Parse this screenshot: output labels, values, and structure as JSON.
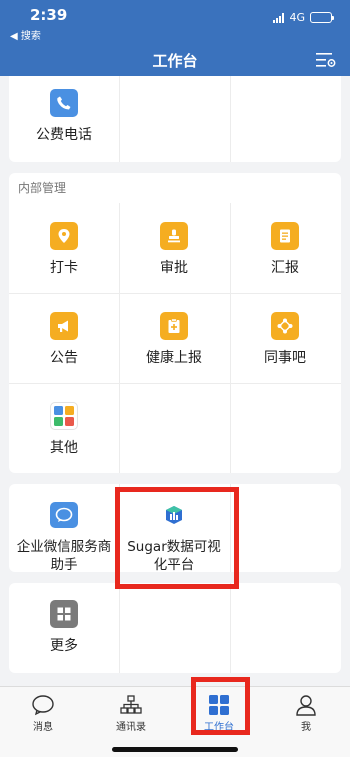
{
  "status": {
    "time": "2:39",
    "back": "◀ 搜索",
    "network": "4G"
  },
  "header": {
    "title": "工作台"
  },
  "section_top": {
    "items": [
      {
        "label": "公费电话",
        "icon": "phone-icon"
      }
    ]
  },
  "section_internal": {
    "title": "内部管理",
    "items": [
      {
        "label": "打卡",
        "icon": "location-pin-icon"
      },
      {
        "label": "审批",
        "icon": "stamp-icon"
      },
      {
        "label": "汇报",
        "icon": "report-doc-icon"
      },
      {
        "label": "公告",
        "icon": "megaphone-icon"
      },
      {
        "label": "健康上报",
        "icon": "health-report-icon"
      },
      {
        "label": "同事吧",
        "icon": "colleague-network-icon"
      },
      {
        "label": "其他",
        "icon": "app-grid-colorful-icon"
      }
    ]
  },
  "section_apps": {
    "items": [
      {
        "label": "企业微信服务商助手",
        "icon": "chat-bubble-icon"
      },
      {
        "label": "Sugar数据可视化平台",
        "icon": "sugar-logo-icon"
      }
    ]
  },
  "section_more": {
    "items": [
      {
        "label": "更多",
        "icon": "more-grid-icon"
      }
    ]
  },
  "tabbar": {
    "tabs": [
      {
        "label": "消息",
        "icon": "message-icon"
      },
      {
        "label": "通讯录",
        "icon": "contacts-org-icon"
      },
      {
        "label": "工作台",
        "icon": "workbench-grid-icon",
        "active": true
      },
      {
        "label": "我",
        "icon": "person-icon"
      }
    ]
  },
  "colors": {
    "header": "#3a72bd",
    "accent": "#2f6fd1",
    "highlight": "#e8281e",
    "icon_yellow": "#f5ad21",
    "icon_blue": "#4a90e2"
  }
}
